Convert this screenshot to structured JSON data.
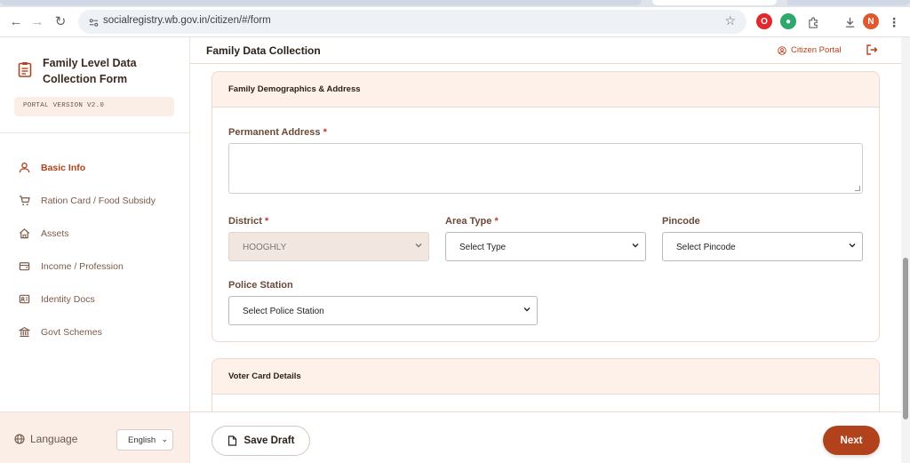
{
  "browser": {
    "url": "socialregistry.wb.gov.in/citizen/#/form",
    "profile_initial": "N"
  },
  "sidebar": {
    "brand_title": "Family Level Data Collection Form",
    "version": "PORTAL VERSION V2.0",
    "items": [
      {
        "label": "Basic Info",
        "icon": "user-icon",
        "active": true
      },
      {
        "label": "Ration Card / Food Subsidy",
        "icon": "cart-icon",
        "active": false
      },
      {
        "label": "Assets",
        "icon": "home-icon",
        "active": false
      },
      {
        "label": "Income / Profession",
        "icon": "wallet-icon",
        "active": false
      },
      {
        "label": "Identity Docs",
        "icon": "id-card-icon",
        "active": false
      },
      {
        "label": "Govt Schemes",
        "icon": "bank-icon",
        "active": false
      }
    ],
    "language_label": "Language",
    "language_value": "English"
  },
  "header": {
    "title": "Family Data Collection",
    "portal_link": "Citizen Portal"
  },
  "section_address": {
    "title": "Family Demographics & Address",
    "permanent_address_label": "Permanent Address",
    "permanent_address_value": "",
    "district_label": "District",
    "district_value": "HOOGHLY",
    "area_type_label": "Area Type",
    "area_type_value": "Select Type",
    "pincode_label": "Pincode",
    "pincode_value": "Select Pincode",
    "police_station_label": "Police Station",
    "police_station_value": "Select Police Station",
    "required_mark": "*"
  },
  "section_voter": {
    "title": "Voter Card Details"
  },
  "actions": {
    "save_draft": "Save Draft",
    "next": "Next"
  },
  "colors": {
    "accent": "#b2421c",
    "section_header_bg": "#fdf1ea"
  }
}
